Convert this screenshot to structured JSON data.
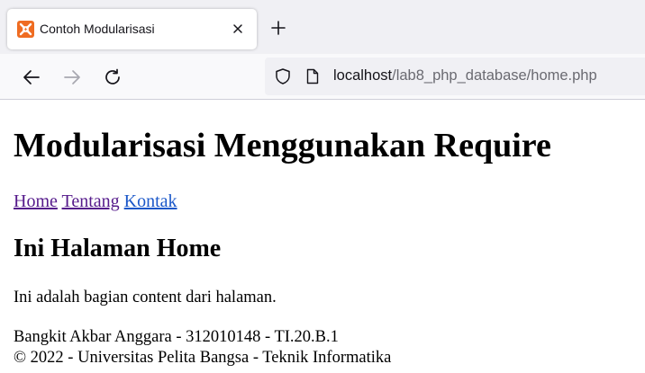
{
  "browser": {
    "tab": {
      "title": "Contoh Modularisasi",
      "favicon": "xampp-favicon-icon"
    },
    "url": {
      "host": "localhost",
      "path": "/lab8_php_database/home.php"
    },
    "accent_color": "#ef6c22"
  },
  "page": {
    "title": "Modularisasi Menggunakan Require",
    "nav": [
      {
        "label": "Home",
        "state": "visited"
      },
      {
        "label": "Tentang",
        "state": "visited"
      },
      {
        "label": "Kontak",
        "state": "unvisited"
      }
    ],
    "section_title": "Ini Halaman Home",
    "content": "Ini adalah bagian content dari halaman.",
    "footer": {
      "line1": "Bangkit Akbar Anggara - 312010148 - TI.20.B.1",
      "line2": "© 2022 - Universitas Pelita Bangsa - Teknik Informatika"
    }
  }
}
